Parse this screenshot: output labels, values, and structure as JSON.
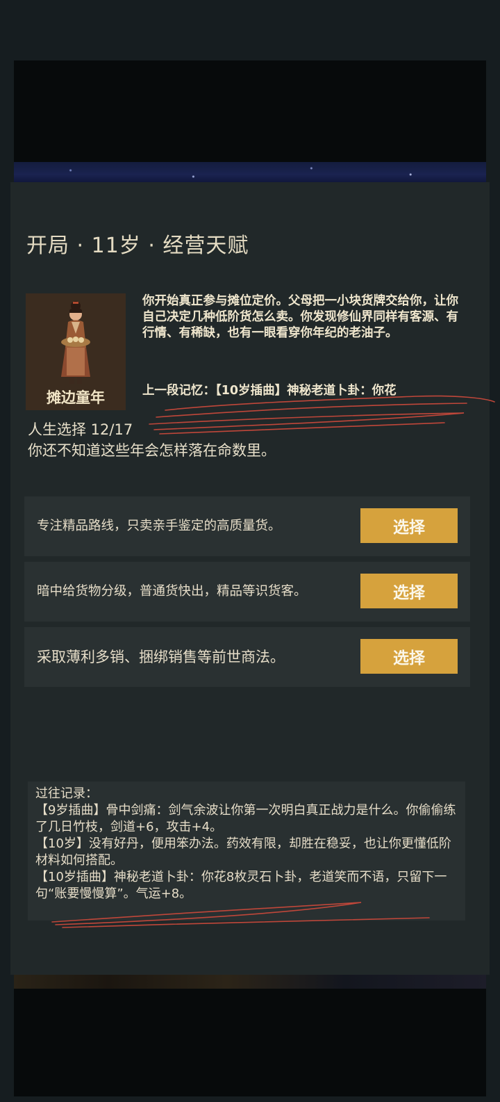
{
  "chapter": {
    "title": "开局 · 11岁 · 经营天赋"
  },
  "stage": {
    "label": "摊边童年",
    "portrait_icon": "merchant-child-portrait"
  },
  "story": {
    "text": "你开始真正参与摊位定价。父母把一小块货牌交给你，让你自己决定几种低阶货怎么卖。你发现修仙界同样有客源、有行情、有稀缺，也有一眼看穿你年纪的老油子。",
    "memory": "上一段记忆：【10岁插曲】神秘老道卜卦：你花"
  },
  "progress": {
    "text": "人生选择 12/17",
    "current": 12,
    "total": 17
  },
  "fate_text": "你还不知道这些年会怎样落在命数里。",
  "choices": [
    {
      "text": "专注精品路线，只卖亲手鉴定的高质量货。",
      "button": "选择"
    },
    {
      "text": "暗中给货物分级，普通货快出，精品等识货客。",
      "button": "选择"
    },
    {
      "text": "采取薄利多销、捆绑销售等前世商法。",
      "button": "选择"
    }
  ],
  "history": {
    "heading": "过往记录：",
    "entries": [
      "【9岁插曲】骨中剑痛：剑气余波让你第一次明白真正战力是什么。你偷偷练了几日竹枝，剑道+6，攻击+4。",
      "【10岁】没有好丹，便用笨办法。药效有限，却胜在稳妥，也让你更懂低阶材料如何搭配。",
      "【10岁插曲】神秘老道卜卦：你花8枚灵石卜卦，老道笑而不语，只留下一句“账要慢慢算”。气运+8。"
    ]
  },
  "colors": {
    "page_bg": "#161d20",
    "panel_bg": "#212829",
    "card_bg": "#2a3132",
    "button_gold": "#d6a23d",
    "text_cream": "#e6ddc8",
    "scribble_red": "#c0473a"
  }
}
